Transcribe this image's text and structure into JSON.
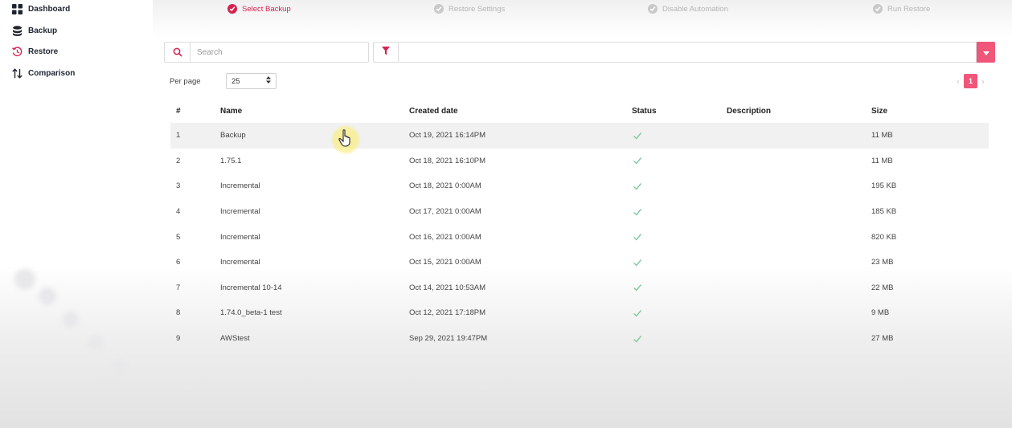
{
  "sidebar": {
    "items": [
      {
        "label": "Dashboard",
        "icon": "grid-icon"
      },
      {
        "label": "Backup",
        "icon": "database-icon"
      },
      {
        "label": "Restore",
        "icon": "history-icon"
      },
      {
        "label": "Comparison",
        "icon": "sort-arrows-icon"
      }
    ]
  },
  "stepper": {
    "steps": [
      {
        "label": "Select Backup",
        "state": "active"
      },
      {
        "label": "Restore Settings",
        "state": "pending"
      },
      {
        "label": "Disable Automation",
        "state": "pending"
      },
      {
        "label": "Run Restore",
        "state": "pending"
      }
    ]
  },
  "toolbar": {
    "search_placeholder": "Search",
    "search_value": "",
    "filter_value": ""
  },
  "pagination": {
    "per_page_label": "Per page",
    "per_page_value": "25",
    "current_page": "1",
    "prev": "‹",
    "next": "›"
  },
  "table": {
    "columns": [
      "#",
      "Name",
      "Created date",
      "Status",
      "Description",
      "Size"
    ],
    "rows": [
      {
        "num": "1",
        "name": "Backup",
        "date": "Oct 19, 2021 16:14PM",
        "status": "ok",
        "description": "",
        "size": "11 MB"
      },
      {
        "num": "2",
        "name": "1.75.1",
        "date": "Oct 18, 2021 16:10PM",
        "status": "ok",
        "description": "",
        "size": "11 MB"
      },
      {
        "num": "3",
        "name": "Incremental",
        "date": "Oct 18, 2021 0:00AM",
        "status": "ok",
        "description": "",
        "size": "195 KB"
      },
      {
        "num": "4",
        "name": "Incremental",
        "date": "Oct 17, 2021 0:00AM",
        "status": "ok",
        "description": "",
        "size": "185 KB"
      },
      {
        "num": "5",
        "name": "Incremental",
        "date": "Oct 16, 2021 0:00AM",
        "status": "ok",
        "description": "",
        "size": "820 KB"
      },
      {
        "num": "6",
        "name": "Incremental",
        "date": "Oct 15, 2021 0:00AM",
        "status": "ok",
        "description": "",
        "size": "23 MB"
      },
      {
        "num": "7",
        "name": "Incremental 10-14",
        "date": "Oct 14, 2021 10:53AM",
        "status": "ok",
        "description": "",
        "size": "22 MB"
      },
      {
        "num": "8",
        "name": "1.74.0_beta-1 test",
        "date": "Oct 12, 2021 17:18PM",
        "status": "ok",
        "description": "",
        "size": "9 MB"
      },
      {
        "num": "9",
        "name": "AWStest",
        "date": "Sep 29, 2021 19:47PM",
        "status": "ok",
        "description": "",
        "size": "27 MB"
      }
    ]
  },
  "colors": {
    "accent": "#d6214f",
    "accent_light": "#f0557a",
    "check": "#7fc9a0"
  }
}
